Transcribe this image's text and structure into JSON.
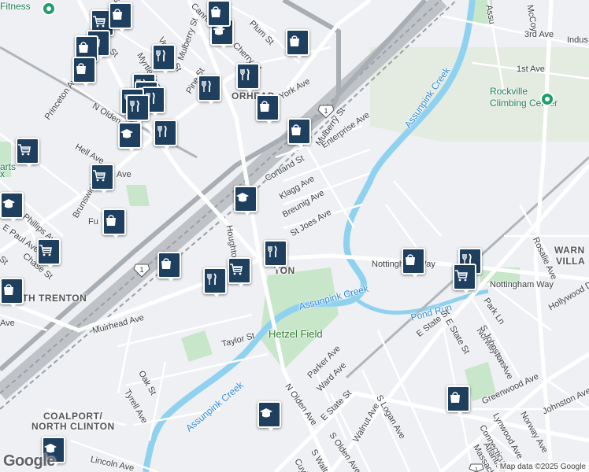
{
  "map": {
    "attribution": "Map data ©2025 Google",
    "logo": "Google",
    "labels": [
      {
        "text": "Fitness",
        "cls": "poi"
      },
      {
        "text": "Rockville",
        "cls": "poi"
      },
      {
        "text": "Climbing Center",
        "cls": "poi"
      },
      {
        "text": "Princeton Ave",
        "cls": ""
      },
      {
        "text": "Princeton Ave",
        "cls": ""
      },
      {
        "text": "N Olden Ave",
        "cls": ""
      },
      {
        "text": "Hell Ave",
        "cls": ""
      },
      {
        "text": "Brunswick Ave",
        "cls": ""
      },
      {
        "text": "Phillips Ave",
        "cls": ""
      },
      {
        "text": "E Paul Ave",
        "cls": ""
      },
      {
        "text": "Chase St",
        "cls": ""
      },
      {
        "text": "NORTH TRENTON",
        "cls": "big"
      },
      {
        "text": "Mulberry St",
        "cls": ""
      },
      {
        "text": "Mulberry St",
        "cls": ""
      },
      {
        "text": "Plum St",
        "cls": ""
      },
      {
        "text": "Cherry St",
        "cls": ""
      },
      {
        "text": "York Ave",
        "cls": ""
      },
      {
        "text": "Pine St",
        "cls": ""
      },
      {
        "text": "Vernon St",
        "cls": ""
      },
      {
        "text": "Myrtle Ave",
        "cls": ""
      },
      {
        "text": "Cortland St",
        "cls": ""
      },
      {
        "text": "Klagg Ave",
        "cls": ""
      },
      {
        "text": "Breunig Ave",
        "cls": ""
      },
      {
        "text": "St Joes Ave",
        "cls": ""
      },
      {
        "text": "Enterprise Ave",
        "cls": ""
      },
      {
        "text": "Houghton Ave",
        "cls": ""
      },
      {
        "text": "Nottingham Way",
        "cls": ""
      },
      {
        "text": "Nottingham Way",
        "cls": ""
      },
      {
        "text": "Assunpink Creek",
        "cls": "water"
      },
      {
        "text": "Assunpink Creek",
        "cls": "water"
      },
      {
        "text": "Assunpink Creek",
        "cls": "water"
      },
      {
        "text": "Pond Run",
        "cls": "water"
      },
      {
        "text": "Hetzel Field",
        "cls": "park"
      },
      {
        "text": "Taylor St",
        "cls": ""
      },
      {
        "text": "Muirhead Ave",
        "cls": ""
      },
      {
        "text": "Oak St",
        "cls": ""
      },
      {
        "text": "Tyrell Ave",
        "cls": ""
      },
      {
        "text": "N Olden Ave",
        "cls": ""
      },
      {
        "text": "Parker Ave",
        "cls": ""
      },
      {
        "text": "Ward Ave",
        "cls": ""
      },
      {
        "text": "E State St",
        "cls": ""
      },
      {
        "text": "E State St",
        "cls": ""
      },
      {
        "text": "E State St",
        "cls": ""
      },
      {
        "text": "S Olden Ave",
        "cls": ""
      },
      {
        "text": "S Logan Ave",
        "cls": ""
      },
      {
        "text": "Walnut Ave",
        "cls": ""
      },
      {
        "text": "Cuyler",
        "cls": ""
      },
      {
        "text": "S Walter",
        "cls": ""
      },
      {
        "text": "COALPORT/",
        "cls": "big"
      },
      {
        "text": "NORTH CLINTON",
        "cls": "big"
      },
      {
        "text": "Lincoln Ave",
        "cls": ""
      },
      {
        "text": "Norway Ave",
        "cls": ""
      },
      {
        "text": "Norway Ave",
        "cls": ""
      },
      {
        "text": "S Johnston Ave",
        "cls": ""
      },
      {
        "text": "Johnston Ave",
        "cls": ""
      },
      {
        "text": "Greenwood Ave",
        "cls": ""
      },
      {
        "text": "Lynwood Ave",
        "cls": ""
      },
      {
        "text": "Connecticut",
        "cls": ""
      },
      {
        "text": "Atlantic A",
        "cls": ""
      },
      {
        "text": "Massachu",
        "cls": ""
      },
      {
        "text": "Park Ln",
        "cls": ""
      },
      {
        "text": "Hollywood Dr",
        "cls": ""
      },
      {
        "text": "Rosalie Ave",
        "cls": ""
      },
      {
        "text": "WARN",
        "cls": "big"
      },
      {
        "text": "VILLA",
        "cls": "big"
      },
      {
        "text": "3rd Ave",
        "cls": ""
      },
      {
        "text": "1st Ave",
        "cls": ""
      },
      {
        "text": "Indus",
        "cls": ""
      },
      {
        "text": "McCoy",
        "cls": ""
      },
      {
        "text": "Assu",
        "cls": ""
      },
      {
        "text": "ORHEAD",
        "cls": "big"
      },
      {
        "text": "TON",
        "cls": "big"
      },
      {
        "text": "arts",
        "cls": "poi"
      },
      {
        "text": "x",
        "cls": "poi"
      },
      {
        "text": "Fu",
        "cls": ""
      },
      {
        "text": "Ave",
        "cls": ""
      },
      {
        "text": "Ave",
        "cls": ""
      },
      {
        "text": "St",
        "cls": ""
      },
      {
        "text": "St",
        "cls": ""
      },
      {
        "text": "Cannin",
        "cls": ""
      }
    ],
    "markers": [
      {
        "icon": "grocery",
        "name": "grocery-marker"
      },
      {
        "icon": "shopping",
        "name": "shopping-marker"
      },
      {
        "icon": "shopping",
        "name": "shopping-marker"
      },
      {
        "icon": "shopping",
        "name": "shopping-marker"
      },
      {
        "icon": "shopping",
        "name": "shopping-marker"
      },
      {
        "icon": "restaurant",
        "name": "restaurant-marker"
      },
      {
        "icon": "restaurant",
        "name": "restaurant-marker"
      },
      {
        "icon": "restaurant",
        "name": "restaurant-marker"
      },
      {
        "icon": "restaurant",
        "name": "restaurant-marker"
      },
      {
        "icon": "restaurant",
        "name": "restaurant-marker"
      },
      {
        "icon": "restaurant",
        "name": "restaurant-marker"
      },
      {
        "icon": "school",
        "name": "school-marker"
      },
      {
        "icon": "restaurant",
        "name": "restaurant-marker"
      },
      {
        "icon": "shopping",
        "name": "shopping-marker"
      },
      {
        "icon": "school",
        "name": "school-marker"
      },
      {
        "icon": "restaurant",
        "name": "restaurant-marker"
      },
      {
        "icon": "restaurant",
        "name": "restaurant-marker"
      },
      {
        "icon": "shopping",
        "name": "shopping-marker"
      },
      {
        "icon": "shopping",
        "name": "shopping-marker"
      },
      {
        "icon": "shopping",
        "name": "shopping-marker"
      },
      {
        "icon": "grocery",
        "name": "grocery-marker"
      },
      {
        "icon": "grocery",
        "name": "grocery-marker"
      },
      {
        "icon": "school",
        "name": "school-marker"
      },
      {
        "icon": "grocery",
        "name": "grocery-marker"
      },
      {
        "icon": "shopping",
        "name": "shopping-marker"
      },
      {
        "icon": "school",
        "name": "school-marker"
      },
      {
        "icon": "restaurant",
        "name": "restaurant-marker"
      },
      {
        "icon": "grocery",
        "name": "grocery-marker"
      },
      {
        "icon": "shopping",
        "name": "shopping-marker"
      },
      {
        "icon": "restaurant",
        "name": "restaurant-marker"
      },
      {
        "icon": "shopping",
        "name": "shopping-marker"
      },
      {
        "icon": "restaurant",
        "name": "restaurant-marker"
      },
      {
        "icon": "grocery",
        "name": "grocery-marker"
      },
      {
        "icon": "shopping",
        "name": "shopping-marker"
      },
      {
        "icon": "school",
        "name": "school-marker"
      },
      {
        "icon": "school",
        "name": "school-marker"
      },
      {
        "icon": "shopping",
        "name": "shopping-marker"
      }
    ],
    "route_shields": [
      "1",
      "1",
      "1"
    ]
  }
}
